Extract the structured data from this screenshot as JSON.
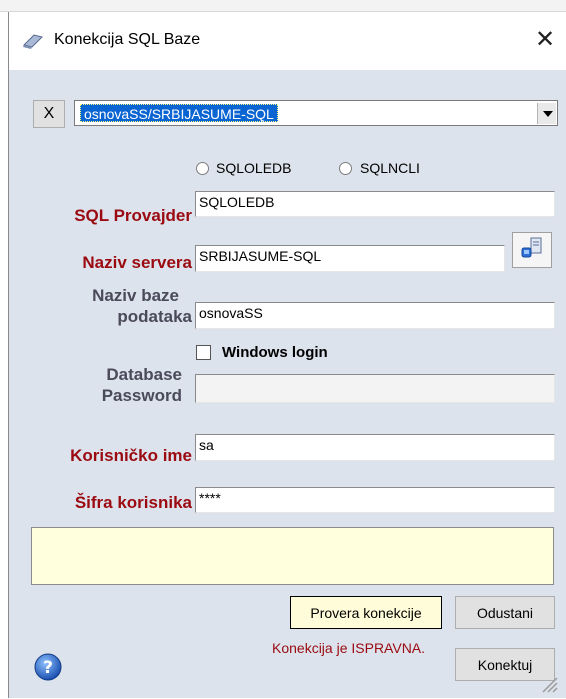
{
  "window": {
    "title": "Konekcija SQL Baze",
    "close_glyph": "✕"
  },
  "connection": {
    "clear_button": "X",
    "selected": "osnovaSS/SRBIJASUME-SQL"
  },
  "provider_options": [
    {
      "label": "SQLOLEDB",
      "selected": false
    },
    {
      "label": "SQLNCLI",
      "selected": false
    }
  ],
  "form": {
    "provider_label": "SQL Provajder",
    "provider_value": "SQLOLEDB",
    "server_label": "Naziv servera",
    "server_value": "SRBIJASUME-SQL",
    "database_label_line1": "Naziv baze",
    "database_label_line2": "podataka",
    "database_value": "osnovaSS",
    "windows_login_label": "Windows login",
    "windows_login_checked": false,
    "db_password_label_line1": "Database",
    "db_password_label_line2": "Password",
    "db_password_value": "",
    "username_label": "Korisničko ime",
    "username_value": "sa",
    "password_label": "Šifra korisnika",
    "password_value": "****"
  },
  "status": {
    "box_text": "",
    "message": "Konekcija je ISPRAVNA."
  },
  "buttons": {
    "test": "Provera konekcije",
    "cancel": "Odustani",
    "connect": "Konektuj"
  },
  "icons": {
    "title": "sql-plug-icon",
    "server_browse": "server-browse-icon",
    "help": "help-icon",
    "grip": "resize-grip-icon"
  },
  "colors": {
    "client_bg": "#dde3ec",
    "label_red": "#9a0a10",
    "label_dark": "#4a4a5a",
    "selection_blue": "#0a64d2",
    "status_bg": "#fffedd"
  }
}
